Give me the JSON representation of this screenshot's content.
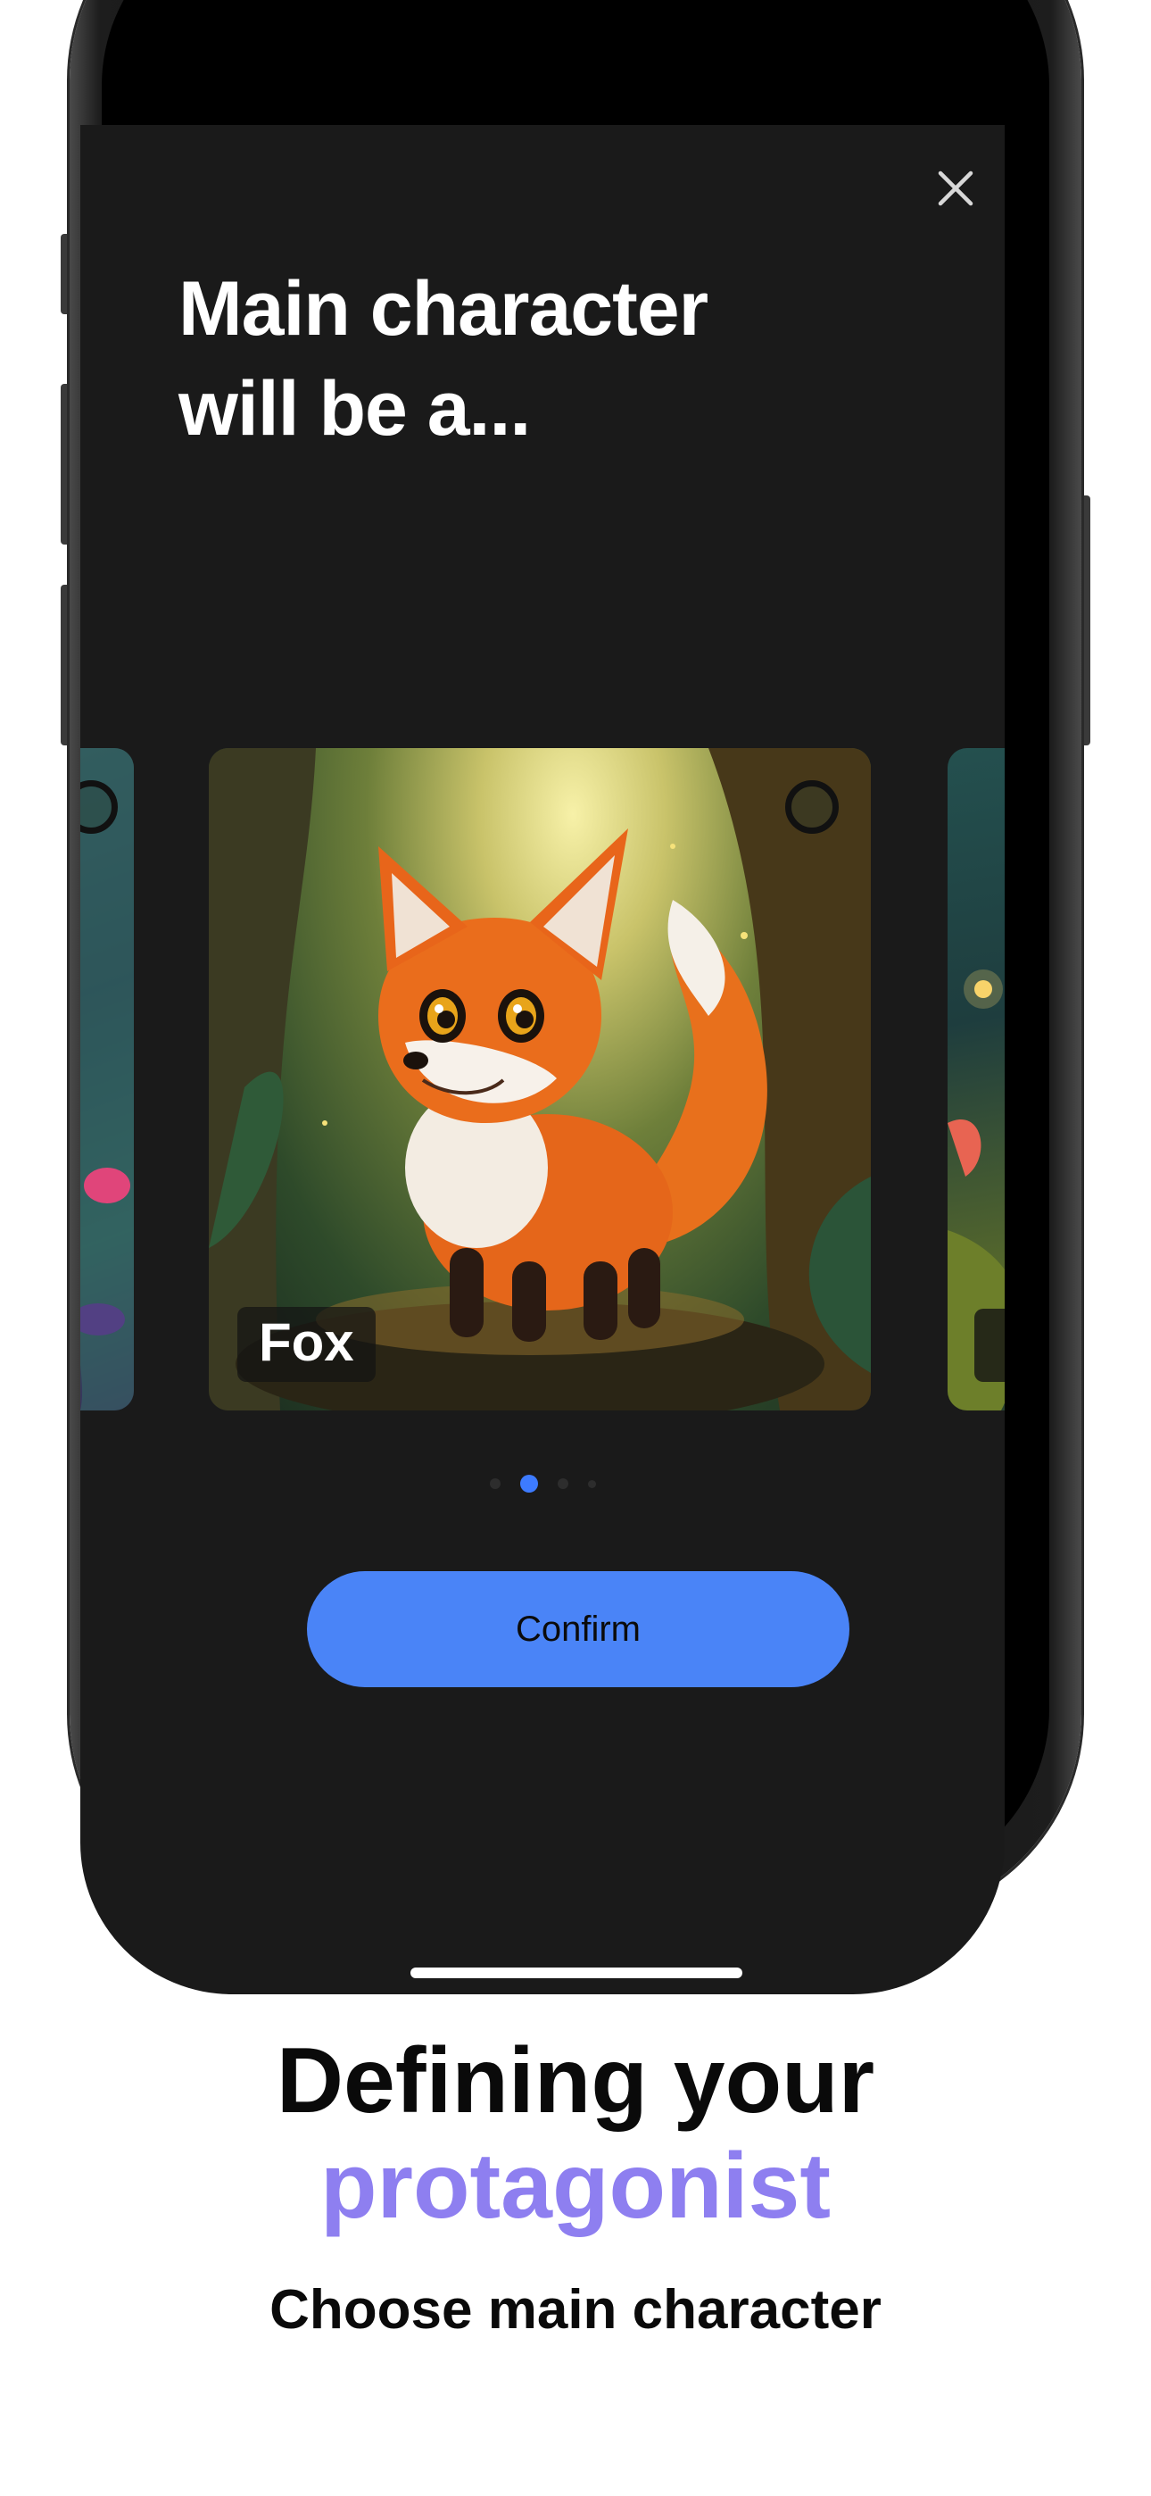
{
  "screen": {
    "title_line1": "Main character",
    "title_line2": "will be a...",
    "close_icon": "close-icon",
    "carousel": {
      "cards": [
        {
          "label": ""
        },
        {
          "label": "Fox",
          "selected": true
        },
        {
          "label": ""
        }
      ],
      "page_count": 4,
      "active_page": 2
    },
    "confirm_label": "Confirm"
  },
  "caption": {
    "headline_line1": "Defining your",
    "headline_line2": "protagonist",
    "subheadline": "Choose main character"
  },
  "colors": {
    "screen_background": "#1a1a1a",
    "primary_button": "#4a84f7",
    "active_dot": "#3d7bff",
    "accent_text": "#8e7ff0",
    "caption_text": "#0a0a0a"
  }
}
